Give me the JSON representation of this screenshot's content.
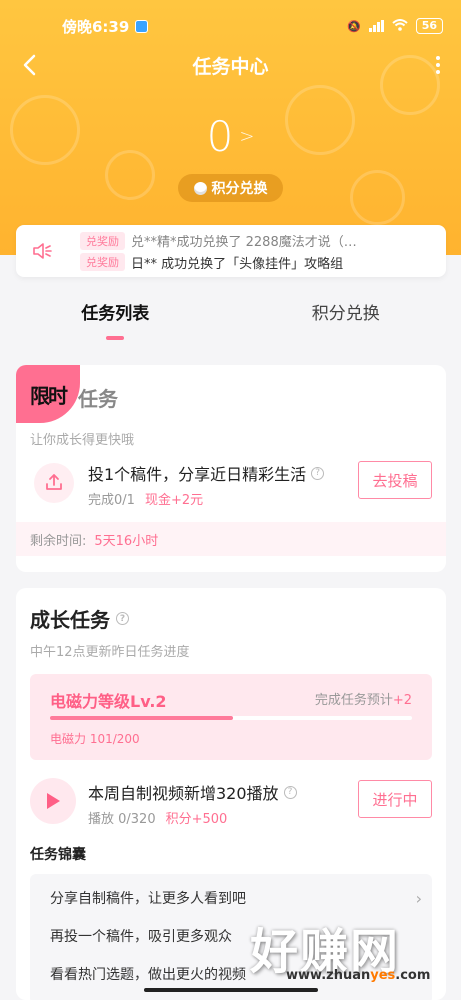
{
  "status_bar": {
    "time": "傍晚6:39",
    "battery": "56"
  },
  "header": {
    "title": "任务中心",
    "points": "0",
    "exchange_pill": "积分兑换"
  },
  "notice": {
    "tag_top": "兑奖励",
    "tag_bottom": "兑奖励",
    "line_top": "兑**精*成功兑换了 2288魔法才说（…",
    "line_bottom": "日** 成功兑换了「头像挂件」攻略组"
  },
  "tabs": [
    {
      "label": "任务列表",
      "active": true
    },
    {
      "label": "积分兑换",
      "active": false
    }
  ],
  "limited_card": {
    "badge": "限时",
    "title": "任务",
    "subtitle": "让你成长得更快哦",
    "task": {
      "title": "投1个稿件，分享近日精彩生活",
      "progress": "完成0/1",
      "reward": "现金+2元",
      "action": "去投稿"
    },
    "remaining_label": "剩余时间:",
    "remaining_value": "5天16小时"
  },
  "growth_card": {
    "title": "成长任务",
    "subtitle": "中午12点更新昨日任务进度",
    "level": {
      "name": "电磁力等级Lv.2",
      "forecast_label": "完成任务预计",
      "forecast_value": "+2",
      "progress_text": "电磁力 101/200",
      "progress_fraction": 0.505
    },
    "task": {
      "title": "本周自制视频新增320播放",
      "progress": "播放 0/320",
      "reward": "积分+500",
      "action": "进行中"
    },
    "tips_heading": "任务锦囊",
    "tips": [
      "分享自制稿件，让更多人看到吧",
      "再投一个稿件，吸引更多观众",
      "看看热门选题，做出更火的视频"
    ]
  },
  "watermark": {
    "main": "好赚网",
    "url_prefix": "www.zhuan",
    "url_highlight": "yes",
    "url_suffix": ".com"
  },
  "colors": {
    "header_gradient_top": "#ffc640",
    "accent_pink": "#ff6f91",
    "light_pink": "#ffe8ee"
  }
}
